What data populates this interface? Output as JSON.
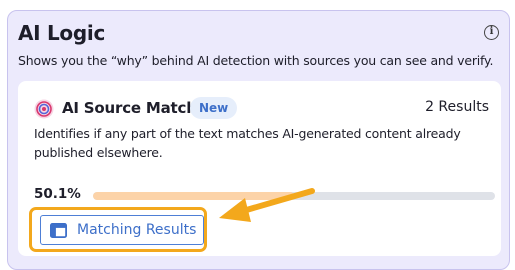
{
  "panel": {
    "title": "AI Logic",
    "subtitle": "Shows you the “why” behind AI detection with sources you can see and verify.",
    "info_icon": "info-circle-icon"
  },
  "card": {
    "icon": "target-swirl-icon",
    "title": "AI Source Match",
    "badge": "New",
    "results": "2 Results",
    "description": "Identifies if any part of the text matches AI-generated content already published elsewhere.",
    "percent_label": "50.1%",
    "progress_fraction": 0.501,
    "button_label": "Matching Results",
    "button_icon": "window-icon"
  },
  "colors": {
    "panel_bg": "#eceafc",
    "accent_blue": "#3d6fc9",
    "progress_fill": "#fcd3a8",
    "highlight_orange": "#f3a81c"
  }
}
